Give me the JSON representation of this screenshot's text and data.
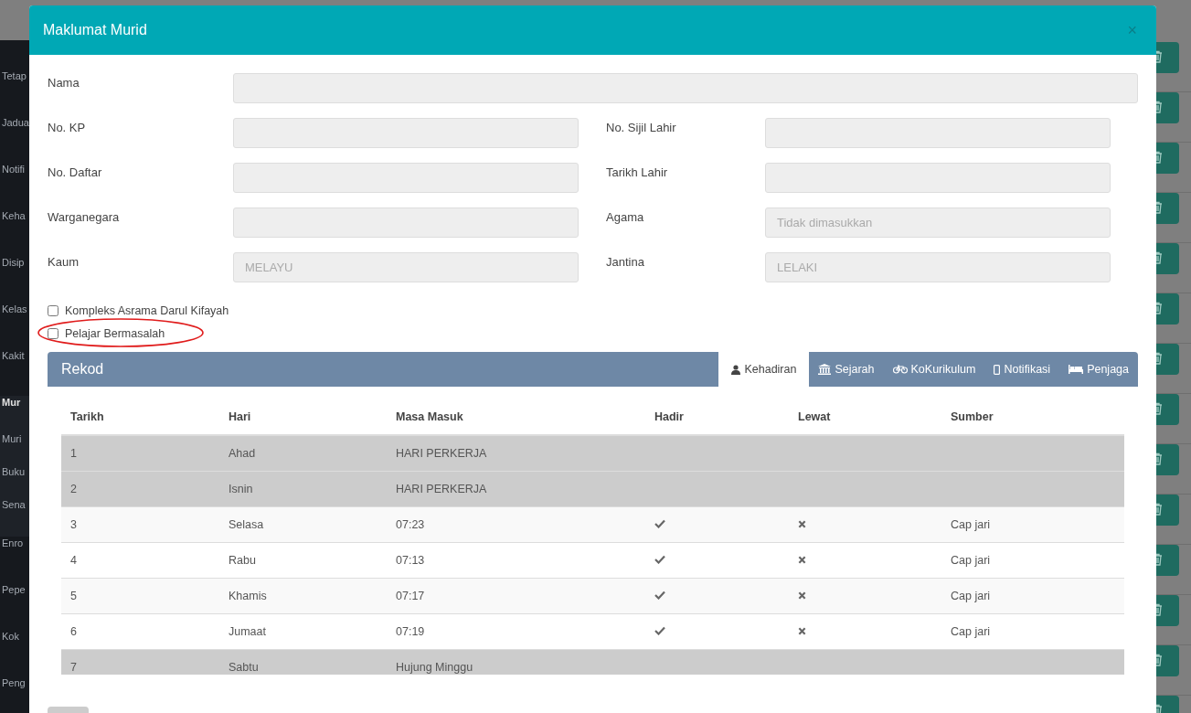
{
  "sidebar": {
    "items": [
      {
        "label": "Tetap",
        "selected": false
      },
      {
        "label": "Jadua",
        "selected": false
      },
      {
        "label": "Notifi",
        "selected": false
      },
      {
        "label": "Keha",
        "selected": false
      },
      {
        "label": "Disip",
        "selected": false
      },
      {
        "label": "Kelas",
        "selected": false
      },
      {
        "label": "Kakit",
        "selected": false
      },
      {
        "label": "Mur",
        "selected": true,
        "children": [
          {
            "label": "Muri"
          },
          {
            "label": "Buku"
          },
          {
            "label": "Sena"
          }
        ]
      },
      {
        "label": "Enro",
        "selected": false
      },
      {
        "label": "Pepe",
        "selected": false
      },
      {
        "label": "Kok",
        "selected": false
      },
      {
        "label": "Peng",
        "selected": false
      }
    ]
  },
  "modal": {
    "title": "Maklumat Murid",
    "close": "×",
    "fields": [
      {
        "label": "Nama"
      },
      {
        "label": "No. KP"
      },
      {
        "label": "No. Sijil Lahir"
      },
      {
        "label": "No. Daftar"
      },
      {
        "label": "Tarikh Lahir"
      },
      {
        "label": "Warganegara"
      },
      {
        "label": "Agama",
        "placeholder": "Tidak dimasukkan"
      },
      {
        "label": "Kaum",
        "value": "MELAYU"
      },
      {
        "label": "Jantina",
        "value": "LELAKI"
      }
    ],
    "checkboxes": [
      {
        "label": "Kompleks Asrama Darul Kifayah",
        "checked": false,
        "circled": false
      },
      {
        "label": "Pelajar Bermasalah",
        "checked": false,
        "circled": true
      }
    ],
    "panel": {
      "title": "Rekod",
      "tabs": [
        {
          "label": "Kehadiran",
          "selected": true
        },
        {
          "label": "Sejarah",
          "selected": false
        },
        {
          "label": "KoKurikulum",
          "selected": false
        },
        {
          "label": "Notifikasi",
          "selected": false
        },
        {
          "label": "Penjaga",
          "selected": false
        }
      ]
    },
    "table": {
      "columns": [
        "Tarikh",
        "Hari",
        "Masa Masuk",
        "Hadir",
        "Lewat",
        "Sumber"
      ],
      "rows": [
        {
          "tarikh": "1",
          "hari": "Ahad",
          "masa": "HARI PERKERJA",
          "highlighted": true
        },
        {
          "tarikh": "2",
          "hari": "Isnin",
          "masa": "HARI PERKERJA",
          "highlighted": true
        },
        {
          "tarikh": "3",
          "hari": "Selasa",
          "masa": "07:23",
          "hadir": true,
          "lewat": false,
          "sumber": "Cap jari",
          "highlighted": false
        },
        {
          "tarikh": "4",
          "hari": "Rabu",
          "masa": "07:13",
          "hadir": true,
          "lewat": false,
          "sumber": "Cap jari",
          "highlighted": false
        },
        {
          "tarikh": "5",
          "hari": "Khamis",
          "masa": "07:17",
          "hadir": true,
          "lewat": false,
          "sumber": "Cap jari",
          "highlighted": false
        },
        {
          "tarikh": "6",
          "hari": "Jumaat",
          "masa": "07:19",
          "hadir": true,
          "lewat": false,
          "sumber": "Cap jari",
          "highlighted": false
        },
        {
          "tarikh": "7",
          "hari": "Sabtu",
          "masa": "Hujung Minggu",
          "highlighted": true
        }
      ]
    }
  }
}
